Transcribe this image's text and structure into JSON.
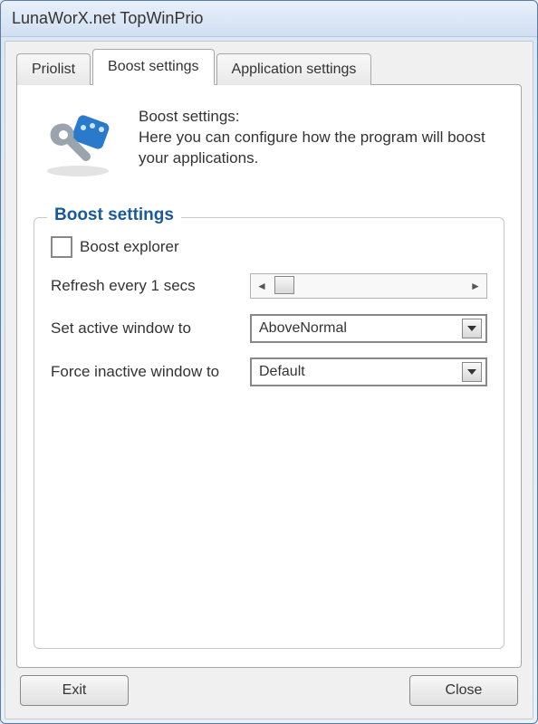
{
  "window": {
    "title": "LunaWorX.net TopWinPrio"
  },
  "tabs": [
    {
      "label": "Priolist",
      "active": false
    },
    {
      "label": "Boost settings",
      "active": true
    },
    {
      "label": "Application settings",
      "active": false
    }
  ],
  "intro": {
    "heading": "Boost settings:",
    "body": "Here you can configure how the program will boost your applications.",
    "icon": "wrench-device-icon"
  },
  "group": {
    "title": "Boost settings",
    "checkbox": {
      "label": "Boost explorer",
      "checked": false
    },
    "refresh": {
      "label": "Refresh every 1 secs"
    },
    "active_window": {
      "label": "Set active window to",
      "value": "AboveNormal"
    },
    "inactive_window": {
      "label": "Force inactive window to",
      "value": "Default"
    }
  },
  "buttons": {
    "exit": "Exit",
    "close": "Close"
  }
}
